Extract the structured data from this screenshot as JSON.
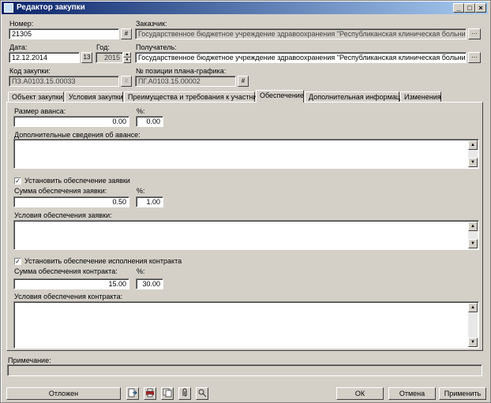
{
  "window": {
    "title": "Редактор закупки"
  },
  "form": {
    "number_label": "Номер:",
    "number_value": "21305",
    "customer_label": "Заказчик:",
    "customer_value": "Государственное бюджетное учреждение здравоохранения \"Республиканская клиническая больница\" Мин",
    "date_label": "Дата:",
    "date_value": "12.12.2014",
    "year_label": "Год:",
    "year_value": "2015",
    "recipient_label": "Получатель:",
    "recipient_value": "Государственное бюджетное учреждение здравоохранения \"Республиканская клиническая больница\" Мин",
    "purchase_code_label": "Код закупки:",
    "purchase_code_value": "ПЗ.А0103.15.00033",
    "plan_position_label": "№ позиции плана-графика:",
    "plan_position_value": "ПГ.А0103.15.00002",
    "hash_icon": "#",
    "ellipsis": "···"
  },
  "tabs": [
    "Объект закупки",
    "Условия закупки",
    "Преимущества и требования к участнику",
    "Обеспечение",
    "Дополнительная информация",
    "Изменения"
  ],
  "active_tab": "Обеспечение",
  "panel": {
    "advance_size_label": "Размер аванса:",
    "advance_size_value": "0.00",
    "advance_pct_label": "%:",
    "advance_pct_value": "0.00",
    "advance_info_label": "Дополнительные сведения об авансе:",
    "application_security_check": "Установить обеспечение заявки",
    "application_security_checked": true,
    "application_amount_label": "Сумма обеспечения заявки:",
    "application_amount_value": "0.50",
    "application_pct_label": "%:",
    "application_pct_value": "1.00",
    "application_terms_label": "Условия обеспечения заявки:",
    "contract_security_check": "Установить обеспечение исполнения контракта",
    "contract_security_checked": true,
    "contract_amount_label": "Сумма обеспечения контракта:",
    "contract_amount_value": "15.00",
    "contract_pct_label": "%:",
    "contract_pct_value": "30.00",
    "contract_terms_label": "Условия обеспечения контракта:"
  },
  "note_label": "Примечание:",
  "buttons": {
    "postponed": "Отложен",
    "ok": "ОК",
    "cancel": "Отмена",
    "apply": "Применить"
  },
  "icons": [
    "export-icon",
    "print-icon",
    "copy-icon",
    "attach-icon",
    "search-icon"
  ]
}
